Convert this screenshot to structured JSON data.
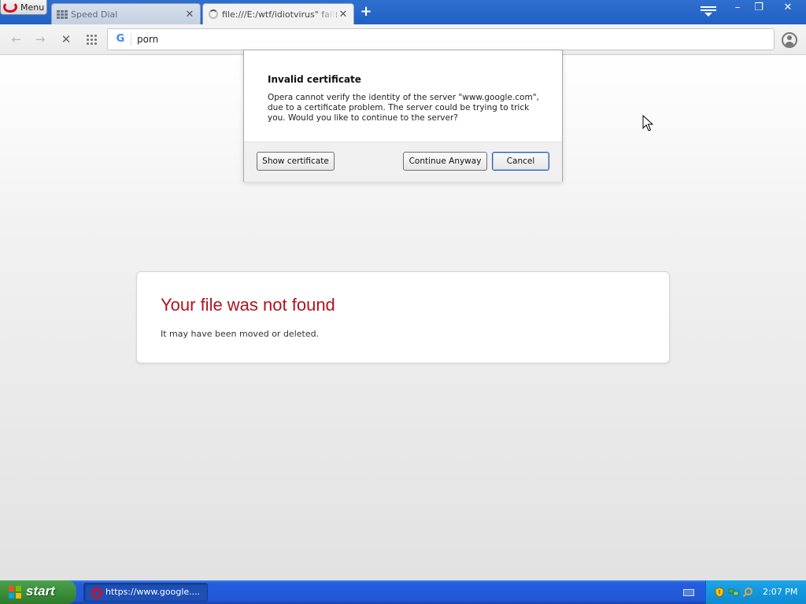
{
  "browser": {
    "menu_label": "Menu",
    "tabs": [
      {
        "label": "Speed Dial",
        "state": "inactive"
      },
      {
        "label": "file:///E:/wtf/idiotvirus\" failed",
        "state": "active-loading"
      }
    ],
    "new_tab_symbol": "+",
    "tab_close_symbol": "✕",
    "window_controls": {
      "minimize": "–",
      "restore": "❐",
      "close": "✕"
    },
    "address_text": "porn",
    "search_engine_icon": "G"
  },
  "toolbar": {
    "back_symbol": "←",
    "forward_symbol": "→",
    "stop_symbol": "✕"
  },
  "dialog": {
    "title": "Invalid certificate",
    "message": "Opera cannot verify the identity of the server \"www.google.com\", due to a certificate problem. The server could be trying to trick you. Would you like to continue to the server?",
    "buttons": {
      "show_certificate": "Show certificate",
      "continue_anyway": "Continue Anyway",
      "cancel": "Cancel"
    }
  },
  "error_page": {
    "title": "Your file was not found",
    "subtitle": "It may have been moved or deleted."
  },
  "taskbar": {
    "start_label": "start",
    "task_label": "https://www.google....",
    "clock": "2:07 PM"
  },
  "colors": {
    "error_title": "#b2121d",
    "titlebar": "#2161c4",
    "start_green": "#3c8f3c",
    "taskbar_blue": "#245edc",
    "tray_blue": "#0d8ad3",
    "opera_red": "#d40f1d"
  },
  "icons": {
    "menu": "opera-logo-icon",
    "speed_dial_tab": "speed-dial-grid-icon",
    "active_tab": "loading-spinner-icon",
    "tab_menu": "tab-menu-icon",
    "apps": "apps-grid-icon",
    "account": "account-icon",
    "tray": [
      "keyboard-icon",
      "security-shield-icon",
      "network-icon",
      "search-icon"
    ]
  }
}
